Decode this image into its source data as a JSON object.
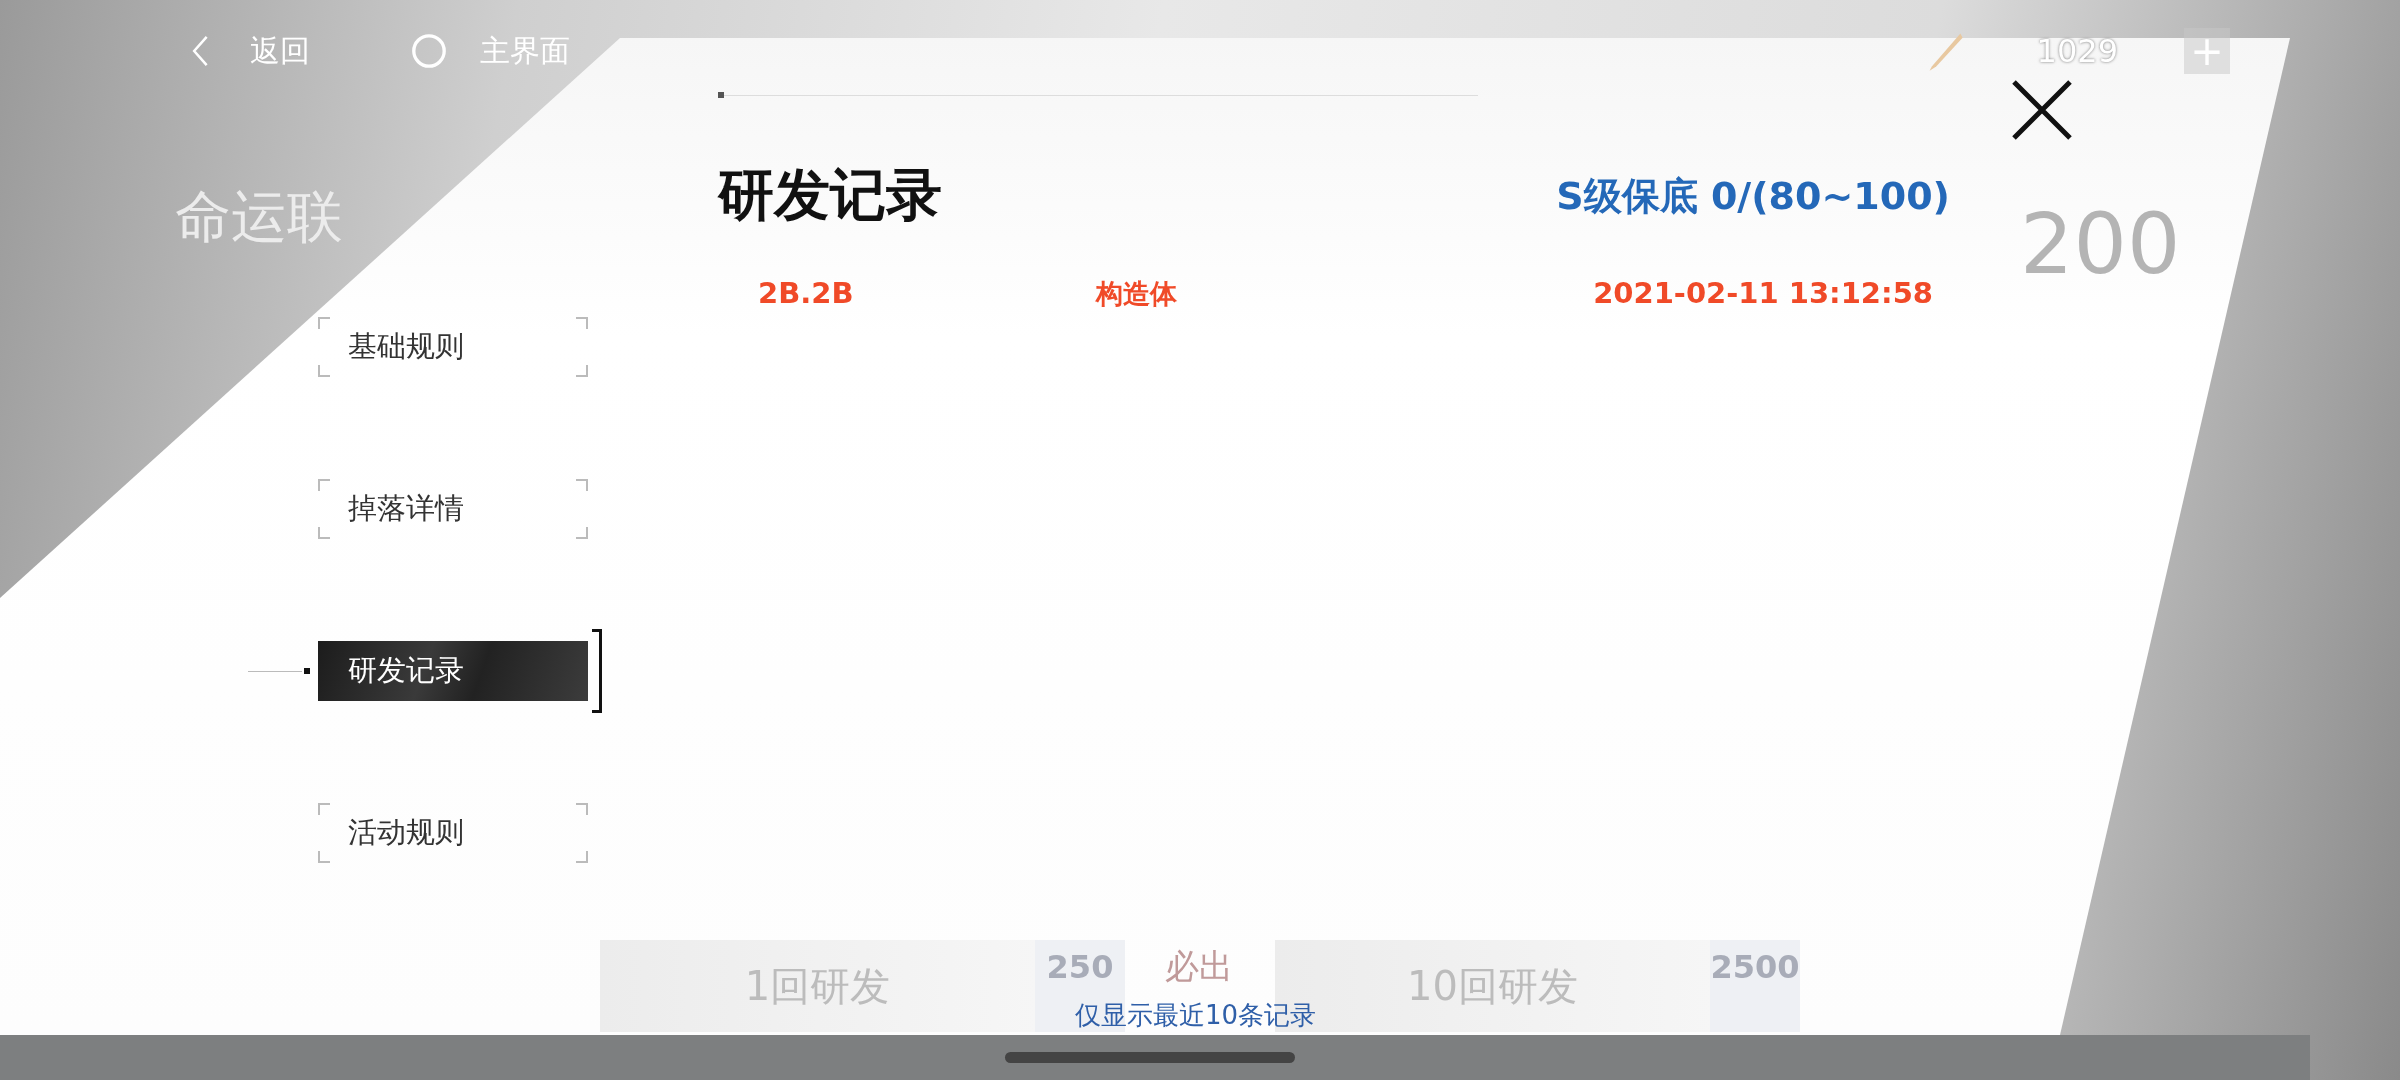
{
  "top_bar": {
    "back_label": "返回",
    "home_label": "主界面",
    "currency": "1029",
    "add": "+"
  },
  "background": {
    "title": "命运联",
    "cost": "200",
    "buttons": [
      {
        "label": "1回研发",
        "price": "250"
      },
      {
        "label": "10回研发",
        "price": "2500",
        "badge": "必出"
      }
    ]
  },
  "menu": [
    {
      "label": "基础规则",
      "selected": false
    },
    {
      "label": "掉落详情",
      "selected": false
    },
    {
      "label": "研发记录",
      "selected": true
    },
    {
      "label": "活动规则",
      "selected": false
    }
  ],
  "panel": {
    "title": "研发记录",
    "pity": "S级保底 0/(80~100)",
    "records": [
      {
        "name": "2B.2B",
        "type": "构造体",
        "time": "2021-02-11 13:12:58"
      }
    ],
    "note": "仅显示最近10条记录"
  }
}
